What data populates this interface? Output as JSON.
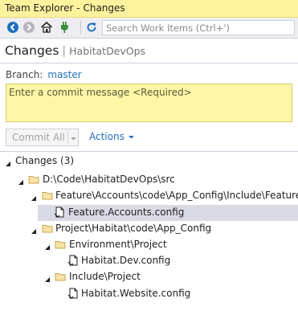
{
  "window": {
    "title": "Team Explorer - Changes"
  },
  "toolbar": {
    "icons": [
      "back-icon",
      "forward-icon",
      "home-icon",
      "connect-icon",
      "refresh-icon"
    ],
    "search_placeholder": "Search Work Items (Ctrl+')"
  },
  "header": {
    "page": "Changes",
    "context": "HabitatDevOps"
  },
  "branch": {
    "label": "Branch:",
    "value": "master"
  },
  "commit": {
    "placeholder": "Enter a commit message <Required>",
    "value": ""
  },
  "buttons": {
    "commit_all": "Commit All",
    "actions": "Actions"
  },
  "colors": {
    "accent": "#1e6fbf",
    "title_bar": "#fff29d",
    "commit_box": "#fff7a6",
    "selected_row": "#dadae6"
  },
  "changes": {
    "header": "Changes (3)",
    "rows": [
      {
        "text": "D:\\Code\\HabitatDevOps\\src",
        "type": "folder"
      },
      {
        "text": "Feature\\Accounts\\code\\App_Config\\Include\\Feature",
        "type": "folder"
      },
      {
        "text": "Feature.Accounts.config",
        "type": "file",
        "selected": true
      },
      {
        "text": "Project\\Habitat\\code\\App_Config",
        "type": "folder"
      },
      {
        "text": "Environment\\Project",
        "type": "folder"
      },
      {
        "text": "Habitat.Dev.config",
        "type": "file"
      },
      {
        "text": "Include\\Project",
        "type": "folder"
      },
      {
        "text": "Habitat.Website.config",
        "type": "file"
      }
    ]
  }
}
